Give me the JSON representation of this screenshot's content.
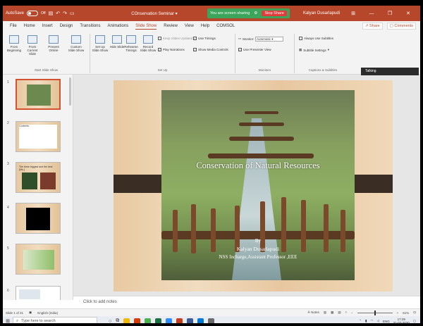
{
  "titlebar": {
    "autosave_label": "AutoSave",
    "autosave_state": "Off",
    "doc_title": "COnservation Seminar",
    "sharing_text": "You are screen sharing",
    "stop_share": "Stop Share",
    "user_name": "Kalyan Dusarlapudi",
    "minimize": "—",
    "restore": "❐",
    "close": "✕"
  },
  "ribbon_tabs": [
    "File",
    "Home",
    "Insert",
    "Design",
    "Transitions",
    "Animations",
    "Slide Show",
    "Review",
    "View",
    "Help",
    "COMSOL"
  ],
  "active_tab": "Slide Show",
  "ribbon_right": {
    "share": "Share",
    "comments": "Comments"
  },
  "ribbon": {
    "start_group": {
      "label": "Start Slide Show",
      "buttons": [
        "From Beginning",
        "From Current Slide",
        "Present Online",
        "Custom Slide Show"
      ]
    },
    "setup_group": {
      "label": "Set Up",
      "buttons": [
        "Set Up Slide Show",
        "Hide Slide",
        "Rehearse Timings",
        "Record Slide Show"
      ],
      "checks": [
        {
          "label": "Keep Slides Updated",
          "checked": false
        },
        {
          "label": "Play Narrations",
          "checked": true
        },
        {
          "label": "Use Timings",
          "checked": true
        },
        {
          "label": "Show Media Controls",
          "checked": true
        }
      ]
    },
    "monitors_group": {
      "label": "Monitors",
      "monitor_label": "Monitor:",
      "monitor_value": "Automatic",
      "presenter_view": "Use Presenter View"
    },
    "captions_group": {
      "label": "Captions & Subtitles",
      "always_subtitles": "Always Use Subtitles",
      "subtitle_settings": "Subtitle Settings"
    }
  },
  "tooltip": "Talking",
  "thumbnails": [
    {
      "num": "1",
      "kind": "photo"
    },
    {
      "num": "2",
      "kind": "text",
      "title": "Contents"
    },
    {
      "num": "3",
      "kind": "images",
      "title": "The three biggest and the best (Ms.)"
    },
    {
      "num": "4",
      "kind": "black"
    },
    {
      "num": "5",
      "kind": "photo2"
    },
    {
      "num": "6",
      "kind": "text2"
    }
  ],
  "slide": {
    "title": "Conservation of Natural Resources",
    "by": "By",
    "author": "Kalyan Dusarlapudi",
    "role": "NSS Incharge,Assistant Professor ,EEE"
  },
  "notes_placeholder": "Click to add notes",
  "statusbar": {
    "slide_info": "Slide 1 of 21",
    "language": "English (India)",
    "notes": "Notes",
    "zoom": "61%"
  },
  "taskbar": {
    "search_placeholder": "Type here to search",
    "language": "ENG",
    "time": "17:29",
    "date": "31-07-2020"
  },
  "colors": {
    "accent": "#b7472a",
    "share_green": "#3ba55c",
    "stop_red": "#e23b3b"
  }
}
